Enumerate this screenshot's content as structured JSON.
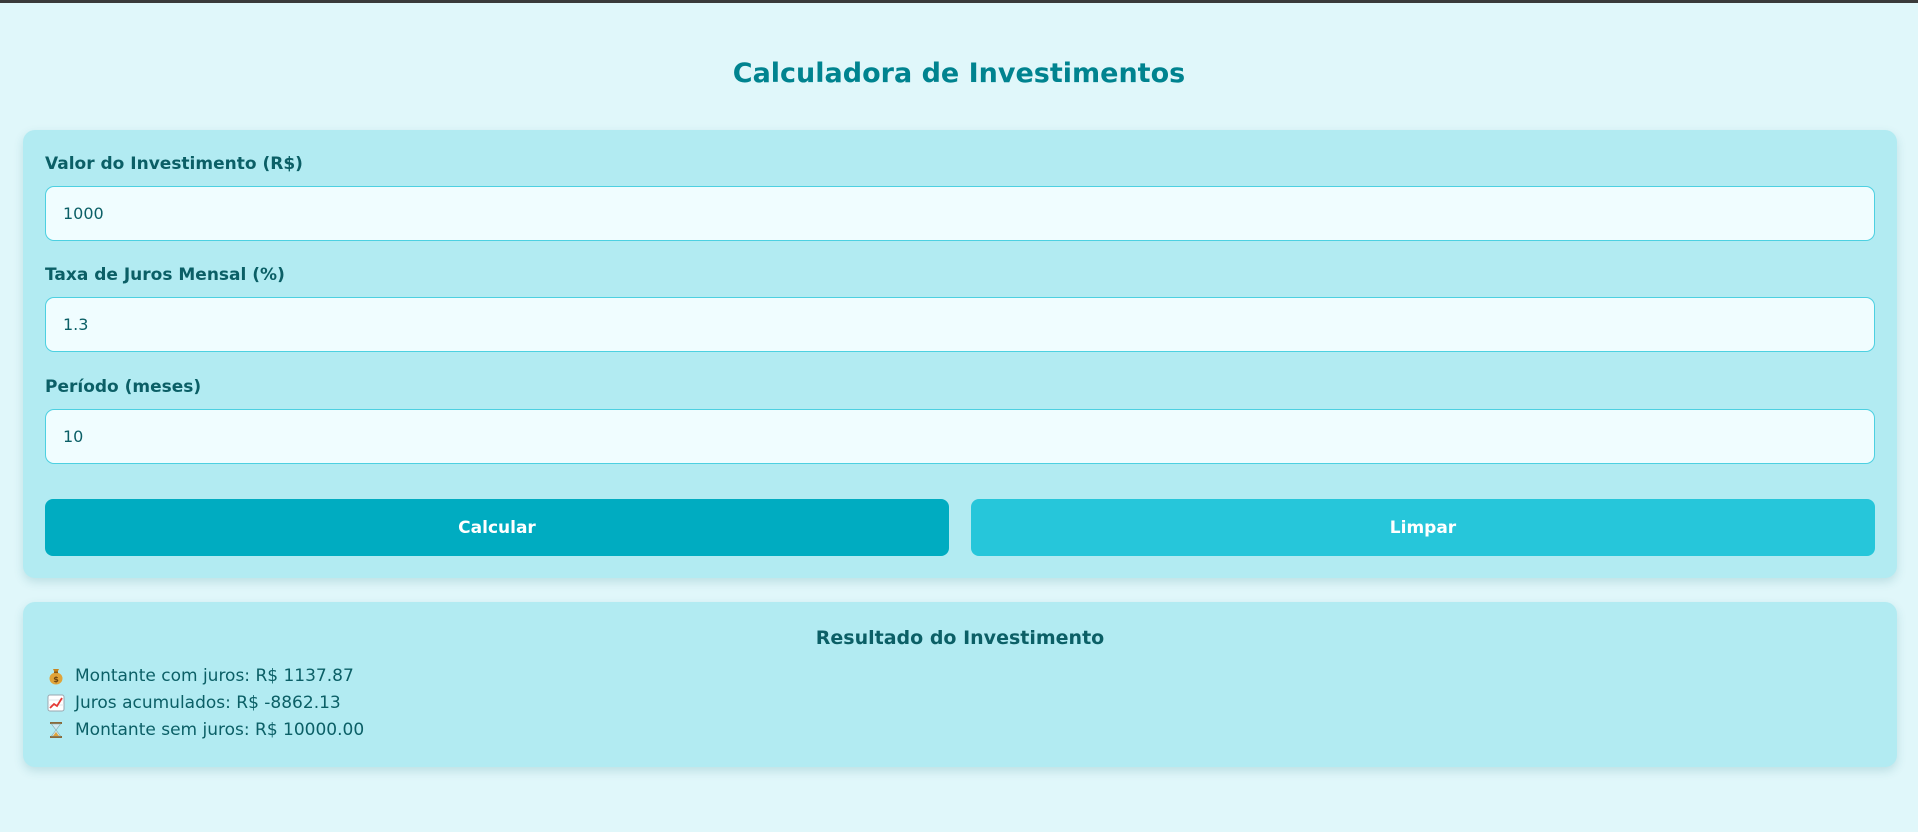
{
  "page": {
    "title": "Calculadora de Investimentos"
  },
  "form": {
    "investment": {
      "label": "Valor do Investimento (R$)",
      "value": "1000"
    },
    "rate": {
      "label": "Taxa de Juros Mensal (%)",
      "value": "1.3"
    },
    "period": {
      "label": "Período (meses)",
      "value": "10"
    },
    "calculate_label": "Calcular",
    "clear_label": "Limpar"
  },
  "result": {
    "title": "Resultado do Investimento",
    "lines": [
      {
        "icon": "money-bag-icon",
        "text": "Montante com juros: R$ 1137.87"
      },
      {
        "icon": "chart-increasing-icon",
        "text": "Juros acumulados: R$ -8862.13"
      },
      {
        "icon": "hourglass-icon",
        "text": "Montante sem juros: R$ 10000.00"
      }
    ]
  },
  "colors": {
    "background": "#e0f7fa",
    "card": "#b2ebf2",
    "title": "#00838f",
    "calculate_button": "#00acc1",
    "clear_button": "#26c6da",
    "text": "#0b5f66"
  }
}
